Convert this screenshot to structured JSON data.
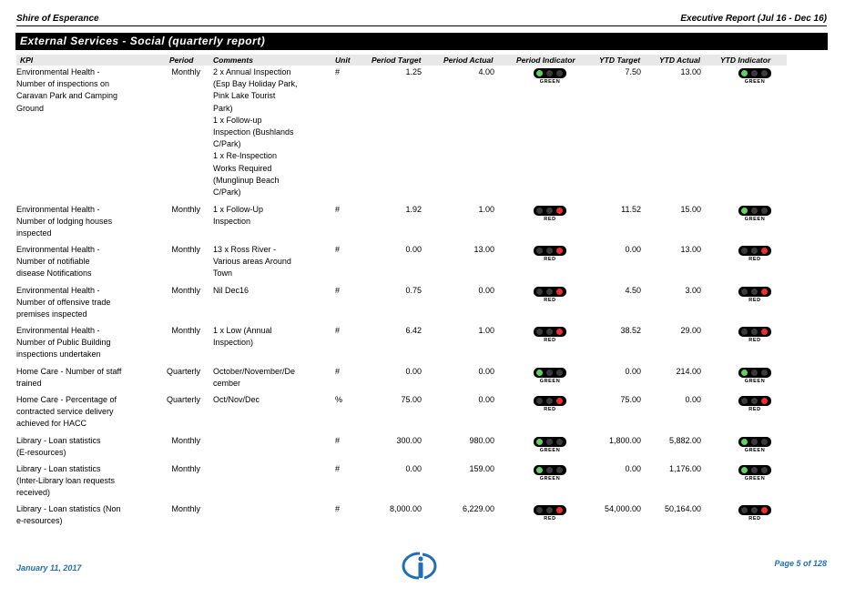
{
  "header": {
    "org": "Shire of Esperance",
    "report": "Executive Report (Jul 16 - Dec 16)"
  },
  "section_title": "External Services - Social (quarterly report)",
  "columns": {
    "kpi": "KPI",
    "period": "Period",
    "comments": "Comments",
    "unit": "Unit",
    "period_target": "Period Target",
    "period_actual": "Period Actual",
    "period_indicator": "Period Indicator",
    "ytd_target": "YTD Target",
    "ytd_actual": "YTD Actual",
    "ytd_indicator": "YTD Indicator"
  },
  "rows": [
    {
      "kpi": "Environmental Health -\nNumber of inspections on\nCaravan Park and Camping\nGround",
      "period": "Monthly",
      "comments": "2 x Annual Inspection\n(Esp Bay Holiday Park,\nPink Lake Tourist\nPark)\n1 x Follow-up\nInspection (Bushlands\nC/Park)\n1 x Re-Inspection\nWorks Required\n(Munglinup Beach\nC/Park)",
      "unit": "#",
      "period_target": "1.25",
      "period_actual": "4.00",
      "period_indicator": "GREEN",
      "ytd_target": "7.50",
      "ytd_actual": "13.00",
      "ytd_indicator": "GREEN"
    },
    {
      "kpi": "Environmental Health -\nNumber of lodging houses\ninspected",
      "period": "Monthly",
      "comments": "1 x Follow-Up\nInspection",
      "unit": "#",
      "period_target": "1.92",
      "period_actual": "1.00",
      "period_indicator": "RED",
      "ytd_target": "11.52",
      "ytd_actual": "15.00",
      "ytd_indicator": "GREEN"
    },
    {
      "kpi": "Environmental Health -\nNumber of notifiable\ndisease Notifications",
      "period": "Monthly",
      "comments": "13 x Ross River -\nVarious areas Around\nTown",
      "unit": "#",
      "period_target": "0.00",
      "period_actual": "13.00",
      "period_indicator": "RED",
      "ytd_target": "0.00",
      "ytd_actual": "13.00",
      "ytd_indicator": "RED"
    },
    {
      "kpi": "Environmental Health -\nNumber of offensive trade\npremises inspected",
      "period": "Monthly",
      "comments": "Nil Dec16",
      "unit": "#",
      "period_target": "0.75",
      "period_actual": "0.00",
      "period_indicator": "RED",
      "ytd_target": "4.50",
      "ytd_actual": "3.00",
      "ytd_indicator": "RED"
    },
    {
      "kpi": "Environmental Health -\nNumber of Public Building\ninspections undertaken",
      "period": "Monthly",
      "comments": "1 x Low (Annual\nInspection)",
      "unit": "#",
      "period_target": "6.42",
      "period_actual": "1.00",
      "period_indicator": "RED",
      "ytd_target": "38.52",
      "ytd_actual": "29.00",
      "ytd_indicator": "RED"
    },
    {
      "kpi": "Home Care - Number of staff\ntrained",
      "period": "Quarterly",
      "comments": "October/November/De\ncember",
      "unit": "#",
      "period_target": "0.00",
      "period_actual": "0.00",
      "period_indicator": "GREEN",
      "ytd_target": "0.00",
      "ytd_actual": "214.00",
      "ytd_indicator": "GREEN"
    },
    {
      "kpi": "Home Care - Percentage of\ncontracted service delivery\nachieved for HACC",
      "period": "Quarterly",
      "comments": "Oct/Nov/Dec",
      "unit": "%",
      "period_target": "75.00",
      "period_actual": "0.00",
      "period_indicator": "RED",
      "ytd_target": "75.00",
      "ytd_actual": "0.00",
      "ytd_indicator": "RED"
    },
    {
      "kpi": "Library - Loan statistics\n(E-resources)",
      "period": "Monthly",
      "comments": "",
      "unit": "#",
      "period_target": "300.00",
      "period_actual": "980.00",
      "period_indicator": "GREEN",
      "ytd_target": "1,800.00",
      "ytd_actual": "5,882.00",
      "ytd_indicator": "GREEN"
    },
    {
      "kpi": "Library - Loan statistics\n(Inter-Library loan requests\nreceived)",
      "period": "Monthly",
      "comments": "",
      "unit": "#",
      "period_target": "0.00",
      "period_actual": "159.00",
      "period_indicator": "GREEN",
      "ytd_target": "0.00",
      "ytd_actual": "1,176.00",
      "ytd_indicator": "GREEN"
    },
    {
      "kpi": "Library - Loan statistics (Non\ne-resources)",
      "period": "Monthly",
      "comments": "",
      "unit": "#",
      "period_target": "8,000.00",
      "period_actual": "6,229.00",
      "period_indicator": "RED",
      "ytd_target": "54,000.00",
      "ytd_actual": "50,164.00",
      "ytd_indicator": "RED"
    }
  ],
  "footer": {
    "date": "January 11, 2017",
    "page": "Page 5 of 128"
  },
  "colors": {
    "green": "#5fd35f",
    "red": "#ef2d2d",
    "footer_text": "#1f6fb8"
  }
}
